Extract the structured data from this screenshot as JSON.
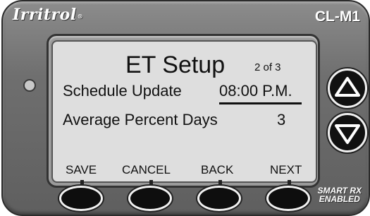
{
  "device": {
    "brand": "Irritrol",
    "brand_mark": "®",
    "model": "CL-M1",
    "badge_line1": "SMART RX",
    "badge_line2": "ENABLED"
  },
  "screen": {
    "title": "ET Setup",
    "page_indicator": "2 of 3",
    "rows": [
      {
        "label": "Schedule Update",
        "value": "08:00 P.M."
      },
      {
        "label": "Average Percent Days",
        "value": "3"
      }
    ],
    "softkeys": [
      "SAVE",
      "CANCEL",
      "BACK",
      "NEXT"
    ]
  },
  "icons": {
    "up": "triangle-up-icon",
    "down": "triangle-down-icon"
  },
  "colors": {
    "housing": "#6f6f6f",
    "lcd": "#dedede",
    "text": "#111111"
  }
}
